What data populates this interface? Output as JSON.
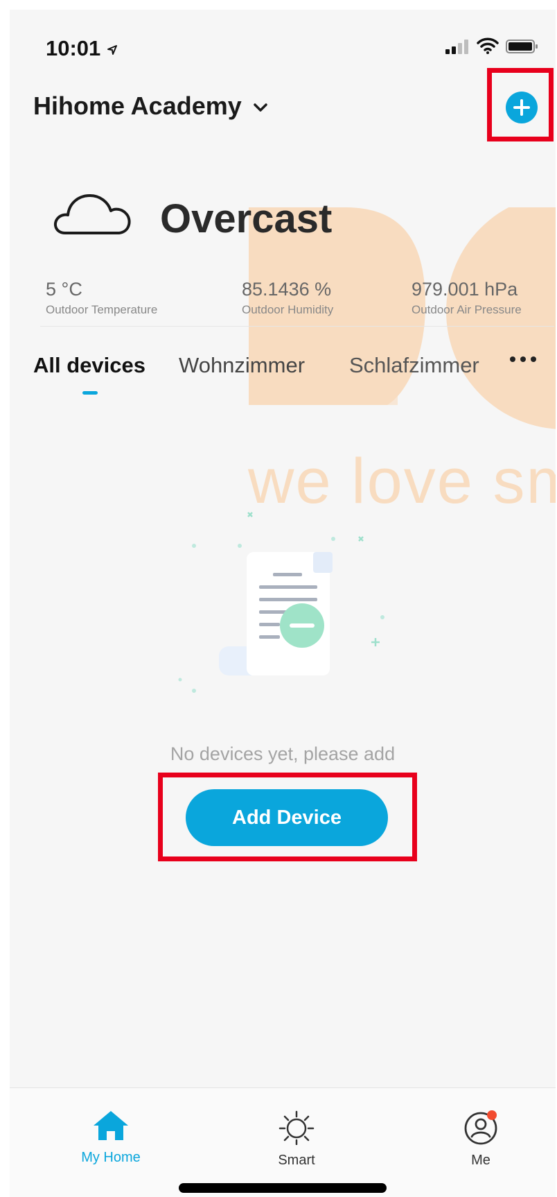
{
  "status": {
    "time": "10:01"
  },
  "header": {
    "home_name": "Hihome Academy"
  },
  "weather": {
    "condition": "Overcast",
    "stats": [
      {
        "value": "5 °C",
        "label": "Outdoor Temperature"
      },
      {
        "value": "85.1436 %",
        "label": "Outdoor Humidity"
      },
      {
        "value": "979.001 hPa",
        "label": "Outdoor Air Pressure"
      }
    ]
  },
  "watermark_text": "we love sm",
  "tabs": [
    {
      "label": "All devices",
      "active": true
    },
    {
      "label": "Wohnzimmer",
      "active": false
    },
    {
      "label": "Schlafzimmer",
      "active": false
    }
  ],
  "empty_state": {
    "message": "No devices yet, please add"
  },
  "add_device_label": "Add Device",
  "bottom_nav": [
    {
      "label": "My Home",
      "icon": "home-icon",
      "active": true
    },
    {
      "label": "Smart",
      "icon": "sun-icon",
      "active": false
    },
    {
      "label": "Me",
      "icon": "profile-icon",
      "active": false,
      "badge": true
    }
  ],
  "colors": {
    "accent": "#0aa6dc",
    "highlight": "#e8001c",
    "badge": "#f24b2f"
  }
}
